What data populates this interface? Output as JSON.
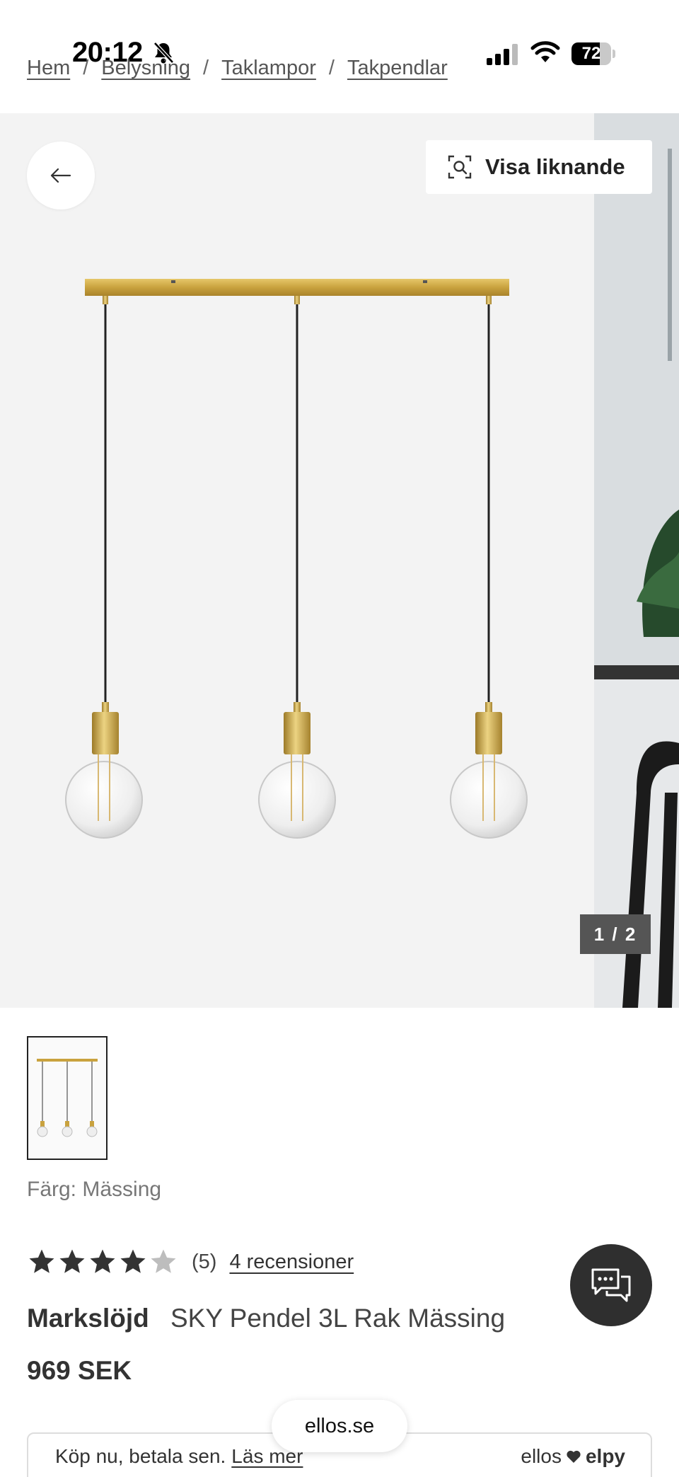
{
  "status_bar": {
    "time": "20:12",
    "battery": "72",
    "battery_level": 0.72
  },
  "breadcrumb": {
    "items": [
      "Hem",
      "Belysning",
      "Taklampor",
      "Takpendlar"
    ],
    "separator": "/"
  },
  "gallery": {
    "similar_label": "Visa liknande",
    "counter": "1 / 2"
  },
  "product": {
    "color_line": "Färg: Mässing",
    "rating_value": 4,
    "rating_max": 5,
    "rating_count": "(5)",
    "reviews_link": "4 recensioner",
    "brand": "Markslöjd",
    "name": "SKY Pendel 3L Rak Mässing",
    "price": "969 SEK"
  },
  "payment": {
    "text": "Köp nu, betala sen.",
    "link": "Läs mer",
    "brand_left": "ellos",
    "brand_right": "elpy"
  },
  "browser": {
    "url": "ellos.se"
  },
  "colors": {
    "brass": "#c9a23e",
    "text": "#333333",
    "chat_bg": "#2f2f2f"
  },
  "icons": [
    "bell-slash-icon",
    "signal-icon",
    "wifi-icon",
    "back-arrow-icon",
    "visual-search-icon",
    "star-icon",
    "chat-icon",
    "heart-icon"
  ]
}
